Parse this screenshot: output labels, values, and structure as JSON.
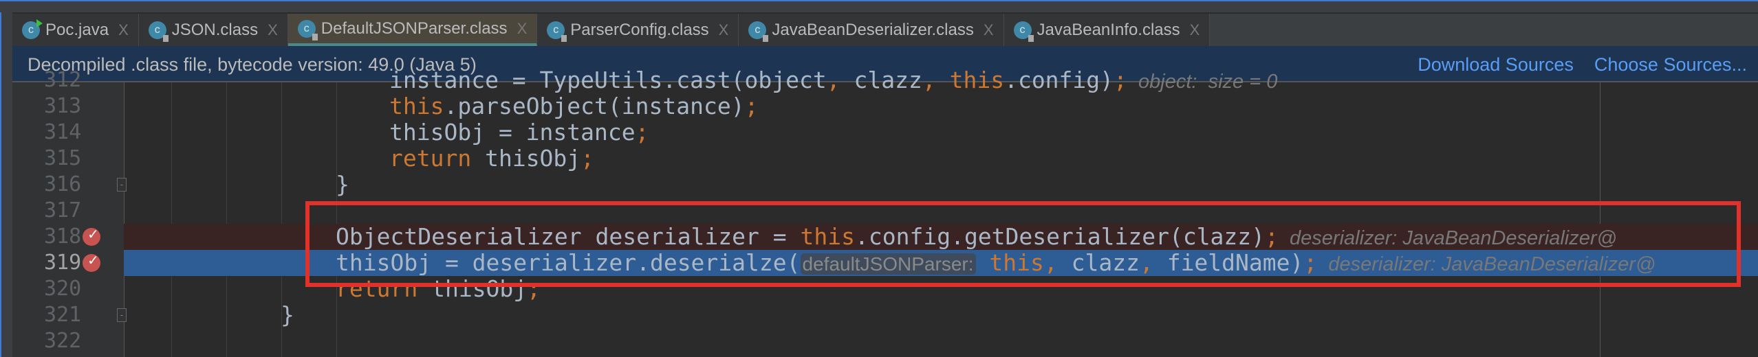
{
  "tabs": [
    {
      "label": "Poc.java",
      "icon": "java-class-run-icon",
      "active": false
    },
    {
      "label": "JSON.class",
      "icon": "class-locked-icon",
      "active": false
    },
    {
      "label": "DefaultJSONParser.class",
      "icon": "class-locked-icon",
      "active": true
    },
    {
      "label": "ParserConfig.class",
      "icon": "class-locked-icon",
      "active": false
    },
    {
      "label": "JavaBeanDeserializer.class",
      "icon": "class-locked-icon",
      "active": false
    },
    {
      "label": "JavaBeanInfo.class",
      "icon": "class-locked-icon",
      "active": false
    }
  ],
  "tab_close": "X",
  "banner": {
    "message": "Decompiled .class file, bytecode version: 49.0 (Java 5)",
    "download_sources": "Download Sources",
    "choose_sources": "Choose Sources..."
  },
  "colors": {
    "keyword": "#cc7832",
    "text": "#a9b7c6",
    "current_line": "#2e5c94",
    "breakpoint_line": "#3a2323",
    "highlight_box": "#e0322a",
    "banner": "#1d3553"
  },
  "lines": [
    {
      "n": "312",
      "indent": 5,
      "segs": [
        [
          "instance = TypeUtils.cast(object",
          "t"
        ],
        [
          ",",
          "kw"
        ],
        [
          " clazz",
          "t"
        ],
        [
          ",",
          "kw"
        ],
        [
          " this",
          "kw"
        ],
        [
          ".config)",
          "t"
        ],
        [
          ";",
          "kw"
        ],
        [
          "  object:  size = 0",
          "hint"
        ]
      ]
    },
    {
      "n": "313",
      "indent": 5,
      "segs": [
        [
          "this",
          "kw"
        ],
        [
          ".parseObject(instance)",
          "t"
        ],
        [
          ";",
          "kw"
        ]
      ]
    },
    {
      "n": "314",
      "indent": 5,
      "segs": [
        [
          "thisObj = instance",
          "t"
        ],
        [
          ";",
          "kw"
        ]
      ]
    },
    {
      "n": "315",
      "indent": 5,
      "segs": [
        [
          "return",
          "kw"
        ],
        [
          " thisObj",
          "t"
        ],
        [
          ";",
          "kw"
        ]
      ]
    },
    {
      "n": "316",
      "indent": 4,
      "fold": true,
      "segs": [
        [
          "}",
          "t"
        ]
      ]
    },
    {
      "n": "317",
      "indent": 4,
      "segs": []
    },
    {
      "n": "318",
      "indent": 4,
      "breakpoint": true,
      "bg": "breakpoint",
      "segs": [
        [
          "ObjectDeserializer deserializer = ",
          "t"
        ],
        [
          "this",
          "kw"
        ],
        [
          ".config.getDeserializer(clazz)",
          "t"
        ],
        [
          ";",
          "kw"
        ],
        [
          "  deserializer: JavaBeanDeserializer@",
          "hint"
        ]
      ]
    },
    {
      "n": "319",
      "indent": 4,
      "breakpoint": true,
      "bg": "current",
      "segs": [
        [
          "thisObj = deserializer.deserialze(",
          "t"
        ],
        [
          "defaultJSONParser:",
          "inlay"
        ],
        [
          " this",
          "kw"
        ],
        [
          ",",
          "kw"
        ],
        [
          " clazz",
          "t"
        ],
        [
          ",",
          "kw"
        ],
        [
          " fieldName)",
          "t"
        ],
        [
          ";",
          "kw"
        ],
        [
          "  deserializer: JavaBeanDeserializer@",
          "hint"
        ]
      ]
    },
    {
      "n": "320",
      "indent": 4,
      "segs": [
        [
          "return",
          "kw"
        ],
        [
          " thisObj",
          "t"
        ],
        [
          ";",
          "kw"
        ]
      ]
    },
    {
      "n": "321",
      "indent": 3,
      "fold": true,
      "segs": [
        [
          "}",
          "t"
        ]
      ]
    },
    {
      "n": "322",
      "indent": 3,
      "segs": []
    }
  ]
}
